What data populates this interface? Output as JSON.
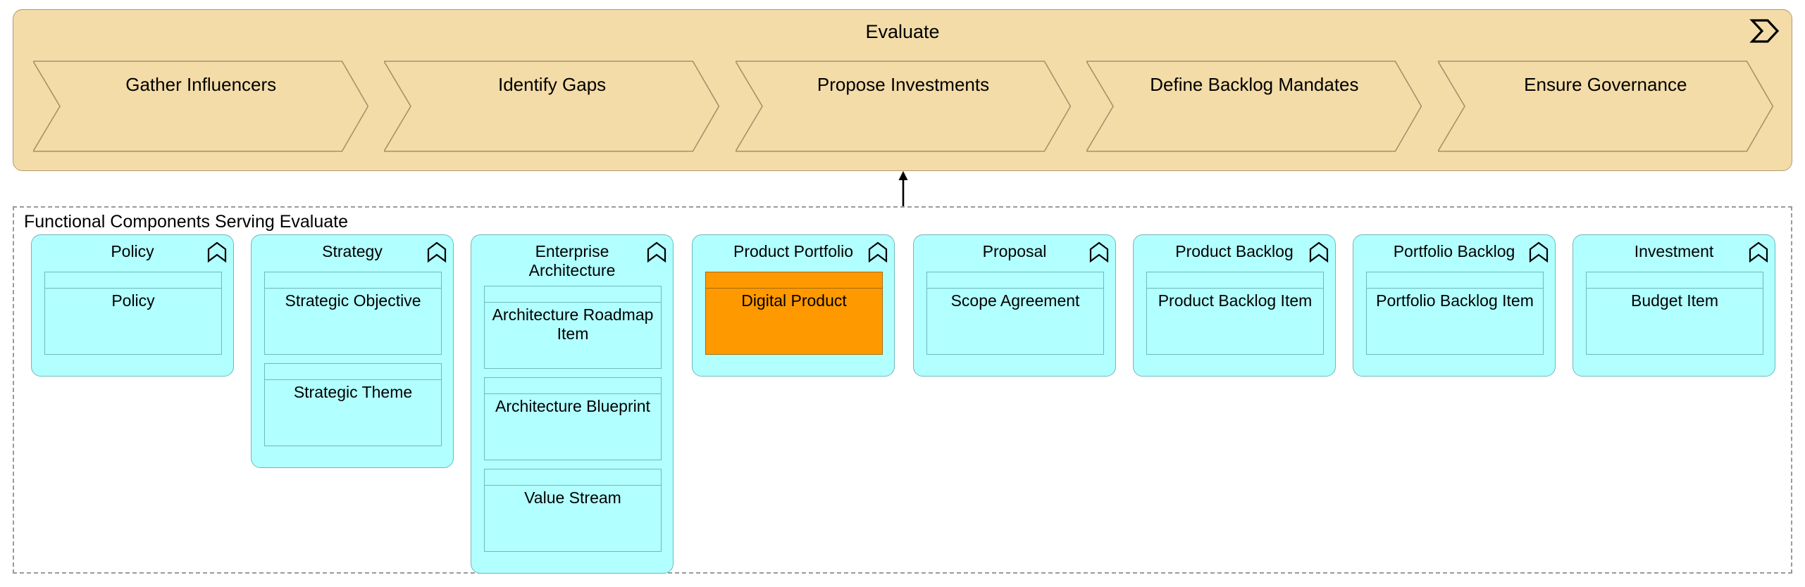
{
  "diagram": {
    "type": "capability-process-map",
    "background": "#ffffff"
  },
  "process_band": {
    "title": "Evaluate",
    "icon": "process-arrow-icon",
    "fill": "#F3DCA8",
    "stroke": "#B39B6E",
    "steps": [
      {
        "label": "Gather Influencers"
      },
      {
        "label": "Identify Gaps"
      },
      {
        "label": "Propose Investments"
      },
      {
        "label": "Define Backlog Mandates"
      },
      {
        "label": "Ensure Governance"
      }
    ]
  },
  "connector": {
    "icon": "up-arrow-icon",
    "from": "functional-components-group",
    "to": "process-band"
  },
  "functional_group": {
    "label": "Functional Components Serving Evaluate",
    "border_style": "dashed",
    "border_color": "#9a9a9a"
  },
  "colors": {
    "capability_fill": "#B2FFFF",
    "capability_stroke": "#6FB9BC",
    "highlight_fill": "#FF9900",
    "highlight_stroke": "#A86A06",
    "band_fill": "#F3DCA8",
    "band_stroke": "#B39B6E"
  },
  "capabilities": [
    {
      "title": "Policy",
      "icon": "function-icon",
      "children": [
        {
          "label": "Policy",
          "highlight": false
        }
      ]
    },
    {
      "title": "Strategy",
      "icon": "function-icon",
      "children": [
        {
          "label": "Strategic Objective",
          "highlight": false
        },
        {
          "label": "Strategic Theme",
          "highlight": false
        }
      ]
    },
    {
      "title": "Enterprise Architecture",
      "icon": "function-icon",
      "children": [
        {
          "label": "Architecture Roadmap Item",
          "highlight": false
        },
        {
          "label": "Architecture Blueprint",
          "highlight": false
        },
        {
          "label": "Value Stream",
          "highlight": false
        }
      ]
    },
    {
      "title": "Product Portfolio",
      "icon": "function-icon",
      "children": [
        {
          "label": "Digital Product",
          "highlight": true
        }
      ]
    },
    {
      "title": "Proposal",
      "icon": "function-icon",
      "children": [
        {
          "label": "Scope Agreement",
          "highlight": false
        }
      ]
    },
    {
      "title": "Product Backlog",
      "icon": "function-icon",
      "children": [
        {
          "label": "Product Backlog Item",
          "highlight": false
        }
      ]
    },
    {
      "title": "Portfolio Backlog",
      "icon": "function-icon",
      "children": [
        {
          "label": "Portfolio Backlog Item",
          "highlight": false
        }
      ]
    },
    {
      "title": "Investment",
      "icon": "function-icon",
      "children": [
        {
          "label": "Budget Item",
          "highlight": false
        }
      ]
    }
  ]
}
